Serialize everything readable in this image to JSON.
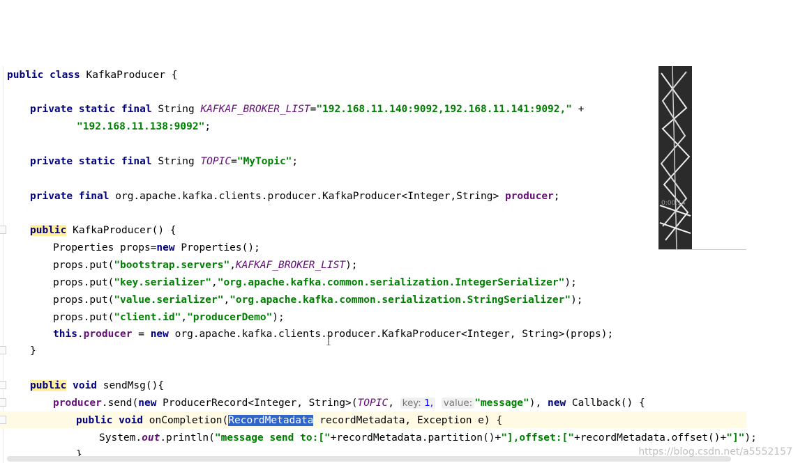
{
  "code": {
    "l1_class": "public class",
    "l1_name": " KafkaProducer {",
    "l2_mods": "private static final",
    "l2_type": " String ",
    "l2_const": "KAFKAF_BROKER_LIST",
    "l2_eq": "=",
    "l2_str": "\"192.168.11.140:9092,192.168.11.141:9092,\"",
    "l2_plus": " +",
    "l3_str": "\"192.168.11.138:9092\"",
    "l3_end": ";",
    "l4_mods": "private static final",
    "l4_type": " String ",
    "l4_const": "TOPIC",
    "l4_eq": "=",
    "l4_str": "\"MyTopic\"",
    "l4_end": ";",
    "l5_mods": "private final",
    "l5_type": " org.apache.kafka.clients.producer.KafkaProducer<Integer,String> ",
    "l5_field": "producer",
    "l5_end": ";",
    "l6_pub": "public",
    "l6_rest": " KafkaProducer() {",
    "l7_a": "Properties props=",
    "l7_new": "new",
    "l7_b": " Properties();",
    "l8_a": "props.put(",
    "l8_str": "\"bootstrap.servers\"",
    "l8_comma": ",",
    "l8_const": "KAFKAF_BROKER_LIST",
    "l8_end": ");",
    "l9_a": "props.put(",
    "l9_str1": "\"key.serializer\"",
    "l9_comma": ",",
    "l9_str2": "\"org.apache.kafka.common.serialization.IntegerSerializer\"",
    "l9_end": ");",
    "l10_a": "props.put(",
    "l10_str1": "\"value.serializer\"",
    "l10_comma": ",",
    "l10_str2": "\"org.apache.kafka.common.serialization.StringSerializer\"",
    "l10_end": ");",
    "l11_a": "props.put(",
    "l11_str1": "\"client.id\"",
    "l11_comma": ",",
    "l11_str2": "\"producerDemo\"",
    "l11_end": ");",
    "l12_this": "this",
    "l12_dot": ".",
    "l12_field": "producer",
    "l12_eq": " = ",
    "l12_new": "new",
    "l12_rest": " org.apache.kafka.clients.producer.KafkaProducer<Integer, String>(props);",
    "l13": "}",
    "l14_pub": "public",
    "l14_void": " void",
    "l14_rest": " sendMsg(){",
    "l15_field": "producer",
    "l15_a": ".send(",
    "l15_new": "new",
    "l15_b": " ProducerRecord<Integer, String>(",
    "l15_const": "TOPIC",
    "l15_comma": ",",
    "l15_hint_key": "key:",
    "l15_key_val": " 1,",
    "l15_hint_value": "value:",
    "l15_str": "\"message\"",
    "l15_c": "), ",
    "l15_new2": "new",
    "l15_d": " Callback() {",
    "l16_pub": "public",
    "l16_void": " void",
    "l16_a": " onCompletion(",
    "l16_sel": "RecordMetadata",
    "l16_b": " recordMetadata, Exception e) {",
    "l17_a": "System.",
    "l17_out": "out",
    "l17_b": ".println(",
    "l17_str1": "\"message send to:[\"",
    "l17_c": "+recordMetadata.partition()+",
    "l17_str2": "\"],offset:[\"",
    "l17_d": "+recordMetadata.offset()+",
    "l17_str3": "\"]\"",
    "l17_end": ");",
    "l18": "}"
  },
  "overlay": {
    "thumbnail_time": "0:00:14"
  },
  "watermark": "https://blog.csdn.net/a5552157",
  "colors": {
    "keyword": "#000080",
    "string": "#008000",
    "constant": "#660e7a",
    "selection": "#2f65ca",
    "current_line": "#fffae3"
  }
}
